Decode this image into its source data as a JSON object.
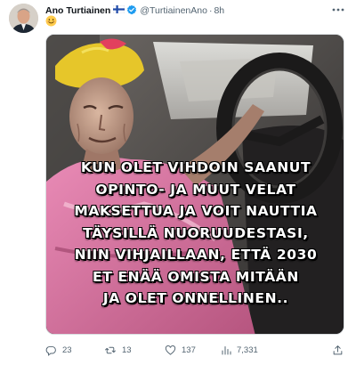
{
  "tweet": {
    "author_name": "Ano Turtiainen",
    "author_flag": "🇫🇮",
    "author_handle": "@TurtiainenAno",
    "separator": "·",
    "timestamp": "8h",
    "body_emoji": "☺",
    "media_caption": [
      "KUN OLET VIHDOIN SAANUT",
      "OPINTO- JA MUUT VELAT",
      "MAKSETTUA JA VOIT NAUTTIA",
      "TÄYSILLÄ NUORUUDESTASI,",
      "NIIN VIHJAILLAAN, ETTÄ 2030",
      "ET ENÄÄ OMISTA MITÄÄN",
      "JA OLET ONNELLINEN.."
    ],
    "metrics": {
      "replies": "23",
      "retweets": "13",
      "likes": "137",
      "views": "7,331"
    }
  },
  "icons": [
    "avatar",
    "finland-flag-icon",
    "verified-badge-icon",
    "more-icon",
    "smiling-emoji-icon",
    "reply-icon",
    "retweet-icon",
    "like-icon",
    "views-icon",
    "share-icon"
  ],
  "colors": {
    "text_primary": "#0f1419",
    "text_secondary": "#536471",
    "verified_blue": "#1d9bf0",
    "emoji_yellow": "#ffcc4d"
  }
}
